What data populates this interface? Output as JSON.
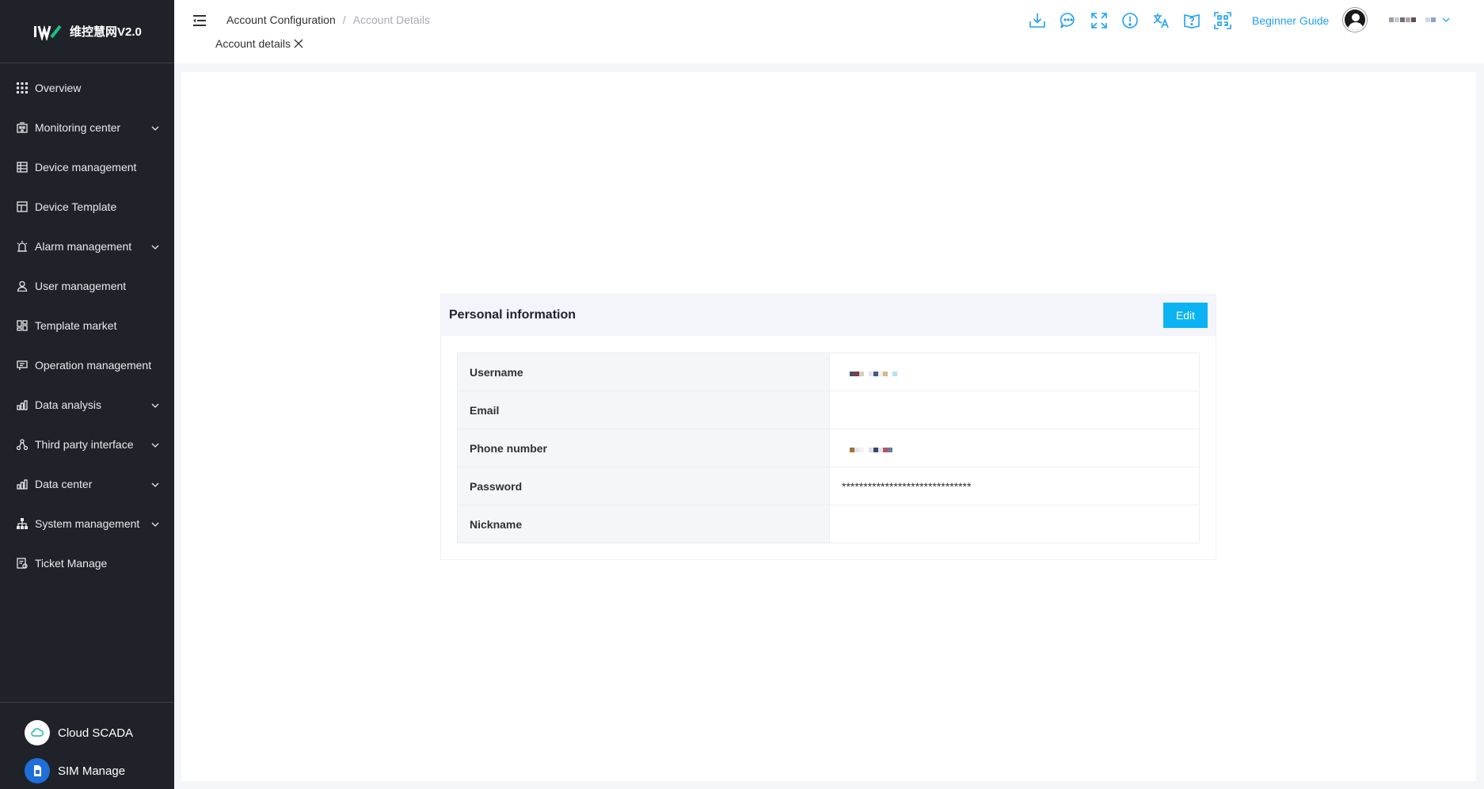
{
  "brand": {
    "name": "维控慧网V2.0",
    "logo": "wecon-logo"
  },
  "sidebar": {
    "items": [
      {
        "label": "Overview",
        "icon": "grid-icon",
        "expandable": false
      },
      {
        "label": "Monitoring center",
        "icon": "building-icon",
        "expandable": true
      },
      {
        "label": "Device management",
        "icon": "device-list-icon",
        "expandable": false
      },
      {
        "label": "Device Template",
        "icon": "template-icon",
        "expandable": false
      },
      {
        "label": "Alarm management",
        "icon": "alarm-icon",
        "expandable": true
      },
      {
        "label": "User management",
        "icon": "user-icon",
        "expandable": false
      },
      {
        "label": "Template market",
        "icon": "market-icon",
        "expandable": false
      },
      {
        "label": "Operation management",
        "icon": "operation-icon",
        "expandable": false
      },
      {
        "label": "Data analysis",
        "icon": "bar-chart-icon",
        "expandable": true
      },
      {
        "label": "Third party interface",
        "icon": "interface-icon",
        "expandable": true
      },
      {
        "label": "Data center",
        "icon": "bar-chart-icon",
        "expandable": true
      },
      {
        "label": "System management",
        "icon": "org-chart-icon",
        "expandable": true
      },
      {
        "label": "Ticket Manage",
        "icon": "ticket-icon",
        "expandable": false
      }
    ],
    "bottom": [
      {
        "label": "Cloud SCADA",
        "icon": "cloud-icon"
      },
      {
        "label": "SIM Manage",
        "icon": "sim-card-icon"
      }
    ]
  },
  "header": {
    "breadcrumb": {
      "first": "Account Configuration",
      "separator": "/",
      "current": "Account Details"
    },
    "tag": {
      "label": "Account details"
    },
    "tools": [
      "download-icon",
      "message-icon",
      "fullscreen-icon",
      "info-icon",
      "translate-icon",
      "help-book-icon",
      "qr-code-icon"
    ],
    "guide_label": "Beginner Guide"
  },
  "card": {
    "title": "Personal information",
    "edit_label": "Edit",
    "rows": [
      {
        "label": "Username",
        "value": "",
        "redacted": true
      },
      {
        "label": "Email",
        "value": "",
        "redacted": false
      },
      {
        "label": "Phone number",
        "value": "",
        "redacted": true
      },
      {
        "label": "Password",
        "value": "******************************",
        "redacted": false
      },
      {
        "label": "Nickname",
        "value": "",
        "redacted": false
      }
    ]
  },
  "colors": {
    "sidebar_bg": "#1f2329",
    "accent": "#1ea0f5",
    "edit_button": "#0bb3f2",
    "card_header_bg": "#f3f5fb"
  }
}
